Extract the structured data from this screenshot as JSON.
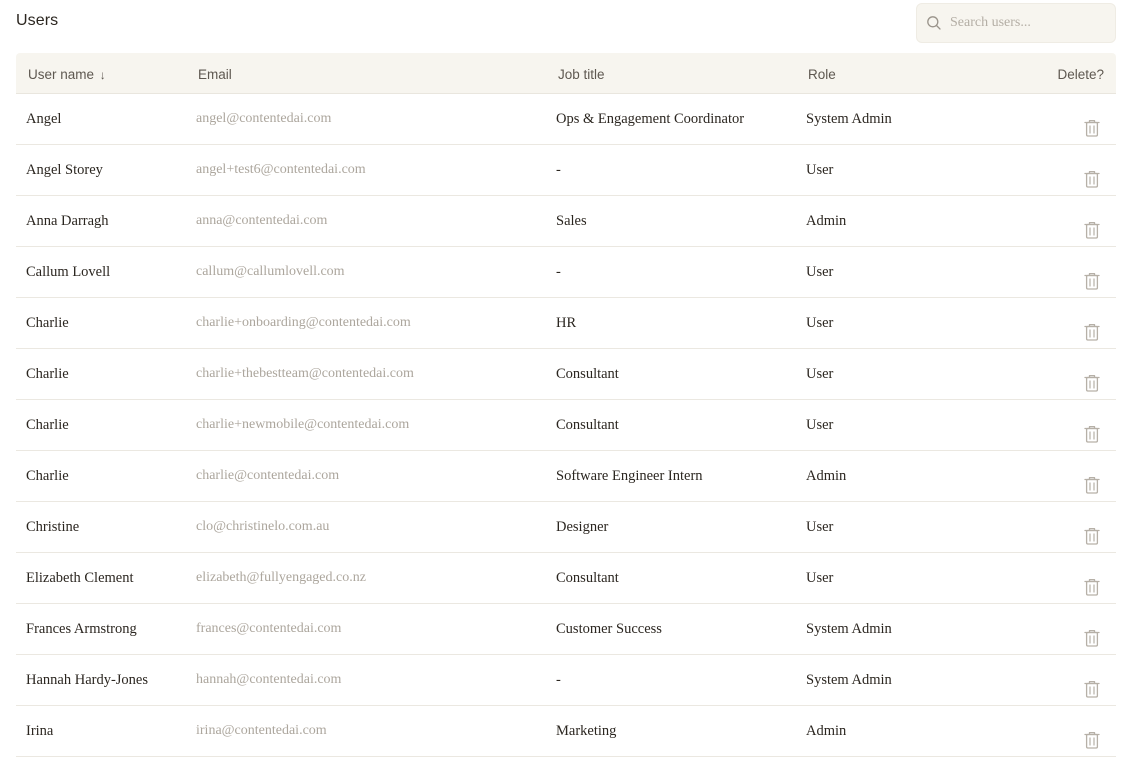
{
  "page": {
    "title": "Users"
  },
  "search": {
    "placeholder": "Search users..."
  },
  "table": {
    "headers": {
      "name": "User name",
      "sort_indicator": "↓",
      "email": "Email",
      "job_title": "Job title",
      "role": "Role",
      "delete": "Delete?"
    },
    "rows": [
      {
        "name": "Angel",
        "email": "angel@contentedai.com",
        "job_title": "Ops & Engagement Coordinator",
        "role": "System Admin"
      },
      {
        "name": "Angel Storey",
        "email": "angel+test6@contentedai.com",
        "job_title": "-",
        "role": "User"
      },
      {
        "name": "Anna Darragh",
        "email": "anna@contentedai.com",
        "job_title": "Sales",
        "role": "Admin"
      },
      {
        "name": "Callum Lovell",
        "email": "callum@callumlovell.com",
        "job_title": "-",
        "role": "User"
      },
      {
        "name": "Charlie",
        "email": "charlie+onboarding@contentedai.com",
        "job_title": "HR",
        "role": "User"
      },
      {
        "name": "Charlie",
        "email": "charlie+thebestteam@contentedai.com",
        "job_title": "Consultant",
        "role": "User"
      },
      {
        "name": "Charlie",
        "email": "charlie+newmobile@contentedai.com",
        "job_title": "Consultant",
        "role": "User"
      },
      {
        "name": "Charlie",
        "email": "charlie@contentedai.com",
        "job_title": "Software Engineer Intern",
        "role": "Admin"
      },
      {
        "name": "Christine",
        "email": "clo@christinelo.com.au",
        "job_title": "Designer",
        "role": "User"
      },
      {
        "name": "Elizabeth Clement",
        "email": "elizabeth@fullyengaged.co.nz",
        "job_title": "Consultant",
        "role": "User"
      },
      {
        "name": "Frances Armstrong",
        "email": "frances@contentedai.com",
        "job_title": "Customer Success",
        "role": "System Admin"
      },
      {
        "name": "Hannah Hardy-Jones",
        "email": "hannah@contentedai.com",
        "job_title": "-",
        "role": "System Admin"
      },
      {
        "name": "Irina",
        "email": "irina@contentedai.com",
        "job_title": "Marketing",
        "role": "Admin"
      }
    ]
  },
  "icons": {
    "search": "search-icon",
    "delete": "trash-icon"
  },
  "colors": {
    "header_bg": "#f7f5ef",
    "email_text": "#aca69d",
    "divider": "#ebe8e1"
  }
}
